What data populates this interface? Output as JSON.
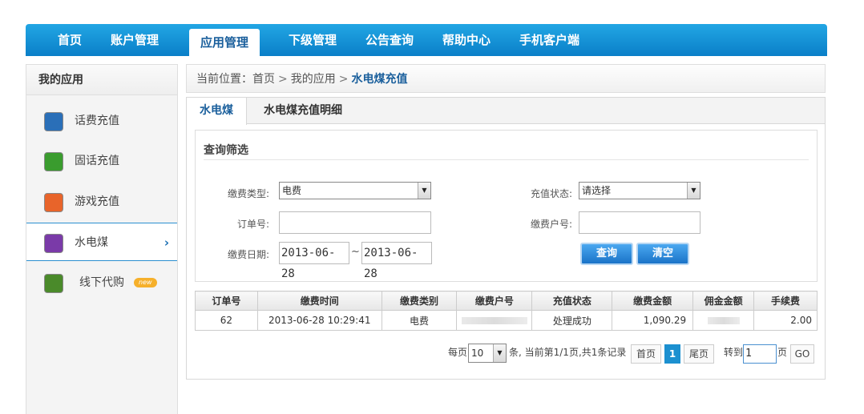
{
  "nav": {
    "items": [
      "首页",
      "账户管理",
      "应用管理",
      "下级管理",
      "公告查询",
      "帮助中心",
      "手机客户端"
    ],
    "active_index": 2
  },
  "sidebar": {
    "title": "我的应用",
    "items": [
      {
        "label": "话费充值",
        "icon": "phone-icon",
        "color": "#2a6fb8"
      },
      {
        "label": "固话充值",
        "icon": "landline-icon",
        "color": "#3a9c2e"
      },
      {
        "label": "游戏充值",
        "icon": "gamepad-icon",
        "color": "#e8642a"
      },
      {
        "label": "水电煤",
        "icon": "utility-icon",
        "color": "#7a3aa8"
      },
      {
        "label": "线下代购",
        "icon": "cart-icon",
        "color": "#4a8a2a"
      }
    ],
    "active_index": 3,
    "badge": "new"
  },
  "breadcrumb": {
    "prefix": "当前位置：",
    "items": [
      "首页",
      "我的应用"
    ],
    "current": "水电煤充值",
    "sep": ">"
  },
  "tabs": [
    "水电煤",
    "水电煤充值明细"
  ],
  "filter": {
    "title": "查询筛选",
    "fee_type_label": "缴费类型:",
    "fee_type_value": "电费",
    "status_label": "充值状态:",
    "status_value": "请选择",
    "order_label": "订单号:",
    "order_value": "",
    "account_label": "缴费户号:",
    "account_value": "",
    "date_label": "缴费日期:",
    "date_from": "2013-06-28",
    "date_to": "2013-06-28",
    "tilde": "~",
    "query_button": "查询",
    "clear_button": "清空"
  },
  "table": {
    "headers": [
      "订单号",
      "缴费时间",
      "缴费类别",
      "缴费户号",
      "充值状态",
      "缴费金额",
      "佣金金额",
      "手续费"
    ],
    "rows": [
      [
        "62",
        "2013-06-28 10:29:41",
        "电费",
        "",
        "处理成功",
        "1,090.29",
        "",
        "2.00"
      ]
    ]
  },
  "pager": {
    "per_page_label": "每页",
    "per_page_value": "10",
    "summary": "条, 当前第1/1页,共1条记录",
    "first": "首页",
    "current_page": "1",
    "last": "尾页",
    "goto_label": "转到",
    "goto_value": "1",
    "page_suffix": "页",
    "go": "GO"
  }
}
